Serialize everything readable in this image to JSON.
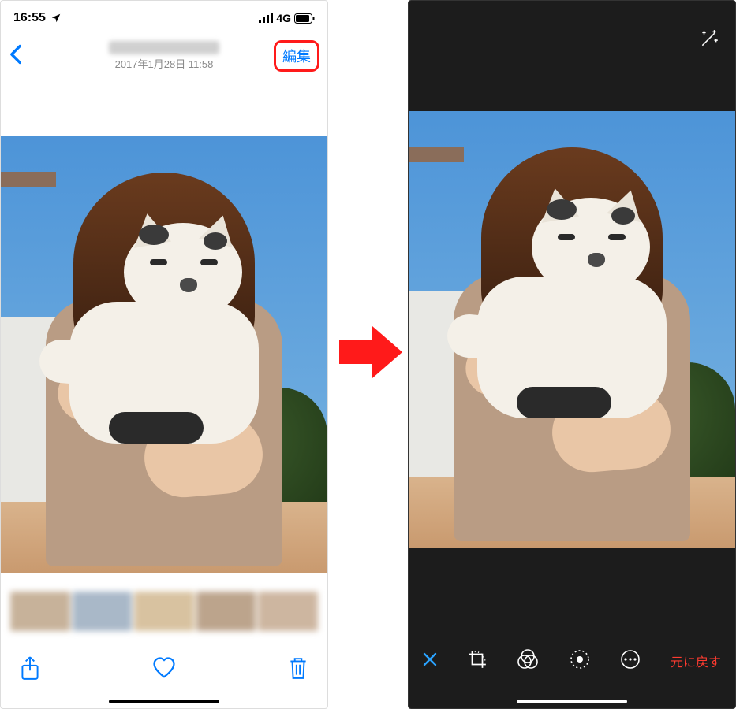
{
  "left_screen": {
    "status": {
      "time": "16:55",
      "network": "4G"
    },
    "nav": {
      "timestamp": "2017年1月28日 11:58",
      "edit_label": "編集"
    },
    "toolbar": {
      "share_name": "share-icon",
      "favorite_name": "heart-icon",
      "delete_name": "trash-icon"
    }
  },
  "right_screen": {
    "top": {
      "wand_name": "magic-wand-icon"
    },
    "toolbar": {
      "close_name": "close-icon",
      "crop_name": "crop-icon",
      "filters_name": "filters-icon",
      "adjust_name": "adjust-icon",
      "more_name": "more-icon",
      "revert_label": "元に戻す"
    }
  }
}
